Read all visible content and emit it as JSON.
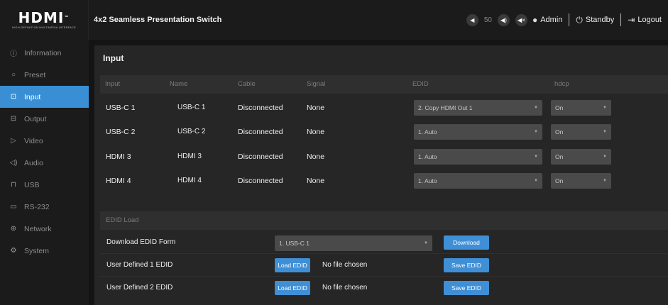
{
  "header": {
    "logo_text": "HDMI",
    "logo_tm": "™",
    "logo_subtitle": "HIGH-DEFINITION MULTIMEDIA INTERFACE",
    "app_title": "4x2 Seamless Presentation Switch",
    "volume_value": "50",
    "user_label": "Admin",
    "standby_label": "Standby",
    "logout_label": "Logout"
  },
  "sidebar": {
    "items": [
      {
        "label": "Information",
        "icon": "info-icon"
      },
      {
        "label": "Preset",
        "icon": "preset-icon"
      },
      {
        "label": "Input",
        "icon": "input-icon",
        "active": true
      },
      {
        "label": "Output",
        "icon": "output-icon"
      },
      {
        "label": "Video",
        "icon": "video-icon"
      },
      {
        "label": "Audio",
        "icon": "audio-icon"
      },
      {
        "label": "USB",
        "icon": "usb-icon"
      },
      {
        "label": "RS-232",
        "icon": "rs232-icon"
      },
      {
        "label": "Network",
        "icon": "network-icon"
      },
      {
        "label": "System",
        "icon": "system-icon"
      }
    ]
  },
  "main": {
    "title": "Input",
    "columns": [
      "Input",
      "Name",
      "Cable",
      "Signal",
      "EDID",
      "hdcp"
    ],
    "rows": [
      {
        "input": "USB-C 1",
        "name": "USB-C 1",
        "cable": "Disconnected",
        "signal": "None",
        "edid": "2. Copy HDMI Out 1",
        "hdcp": "On"
      },
      {
        "input": "USB-C 2",
        "name": "USB-C 2",
        "cable": "Disconnected",
        "signal": "None",
        "edid": "1. Auto",
        "hdcp": "On"
      },
      {
        "input": "HDMI 3",
        "name": "HDMI 3",
        "cable": "Disconnected",
        "signal": "None",
        "edid": "1. Auto",
        "hdcp": "On"
      },
      {
        "input": "HDMI 4",
        "name": "HDMI 4",
        "cable": "Disconnected",
        "signal": "None",
        "edid": "1. Auto",
        "hdcp": "On"
      }
    ],
    "edid_load": {
      "section_label": "EDID Load",
      "download_label": "Download EDID Form",
      "download_select": "1. USB-C 1",
      "download_button": "Download",
      "user1_label": "User Defined 1 EDID",
      "user2_label": "User Defined 2 EDID",
      "load_button": "Load EDID",
      "no_file": "No file chosen",
      "save_button": "Save EDID"
    }
  },
  "colors": {
    "accent": "#3a8fd4",
    "background": "#141414",
    "panel": "#262626",
    "select": "#4a4a4a"
  }
}
